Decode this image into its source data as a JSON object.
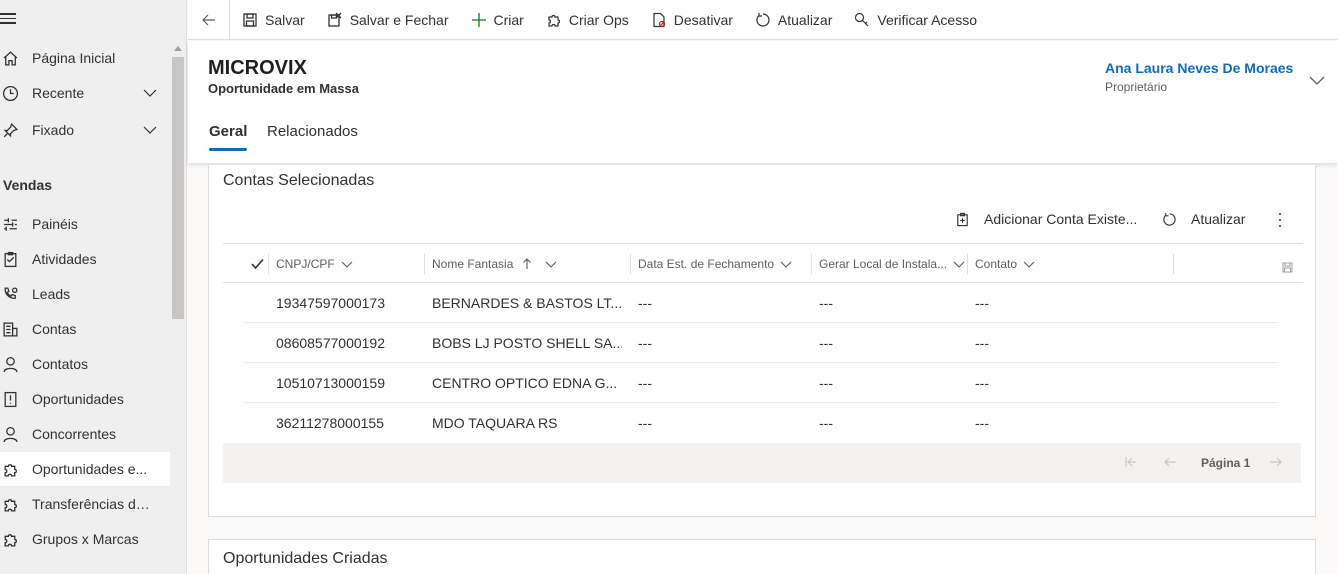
{
  "sidebar": {
    "items": [
      {
        "label": "Página Inicial",
        "icon": "home-icon"
      },
      {
        "label": "Recente",
        "icon": "clock-icon"
      },
      {
        "label": "Fixado",
        "icon": "pin-icon"
      },
      {
        "label": "Painéis",
        "icon": "dashboard-icon"
      },
      {
        "label": "Atividades",
        "icon": "clipboard-icon"
      },
      {
        "label": "Leads",
        "icon": "phone-person-icon"
      },
      {
        "label": "Contas",
        "icon": "building-icon"
      },
      {
        "label": "Contatos",
        "icon": "person-icon"
      },
      {
        "label": "Oportunidades",
        "icon": "alert-document-icon"
      },
      {
        "label": "Concorrentes",
        "icon": "person-icon"
      },
      {
        "label": "Oportunidades e...",
        "icon": "puzzle-icon"
      },
      {
        "label": "Transferências de ...",
        "icon": "puzzle-icon"
      },
      {
        "label": "Grupos x Marcas",
        "icon": "puzzle-icon"
      }
    ],
    "section_label": "Vendas"
  },
  "commandbar": {
    "save": "Salvar",
    "save_close": "Salvar e Fechar",
    "create": "Criar",
    "create_ops": "Criar Ops",
    "deactivate": "Desativar",
    "refresh": "Atualizar",
    "check_access": "Verificar Acesso"
  },
  "header": {
    "title": "MICROVIX",
    "subtitle": "Oportunidade em Massa",
    "owner_name": "Ana Laura Neves De Moraes",
    "owner_role": "Proprietário",
    "tabs": [
      "Geral",
      "Relacionados"
    ]
  },
  "accounts": {
    "title": "Contas Selecionadas",
    "add_existing": "Adicionar Conta Existe...",
    "refresh": "Atualizar",
    "columns": [
      "CNPJ/CPF",
      "Nome Fantasia",
      "Data Est. de Fechamento",
      "Gerar Local de Instala...",
      "Contato"
    ],
    "rows": [
      [
        "19347597000173",
        "BERNARDES & BASTOS LT...",
        "---",
        "---",
        "---"
      ],
      [
        "08608577000192",
        "BOBS LJ POSTO SHELL SA...",
        "---",
        "---",
        "---"
      ],
      [
        "10510713000159",
        "CENTRO OPTICO EDNA G...",
        "---",
        "---",
        "---"
      ],
      [
        "36211278000155",
        "MDO TAQUARA RS",
        "---",
        "---",
        "---"
      ]
    ],
    "page_label": "Página 1"
  },
  "opportunities": {
    "title": "Oportunidades Criadas"
  },
  "colors": {
    "accent": "#0f6cbd",
    "sidebar_bg": "#efefef"
  }
}
